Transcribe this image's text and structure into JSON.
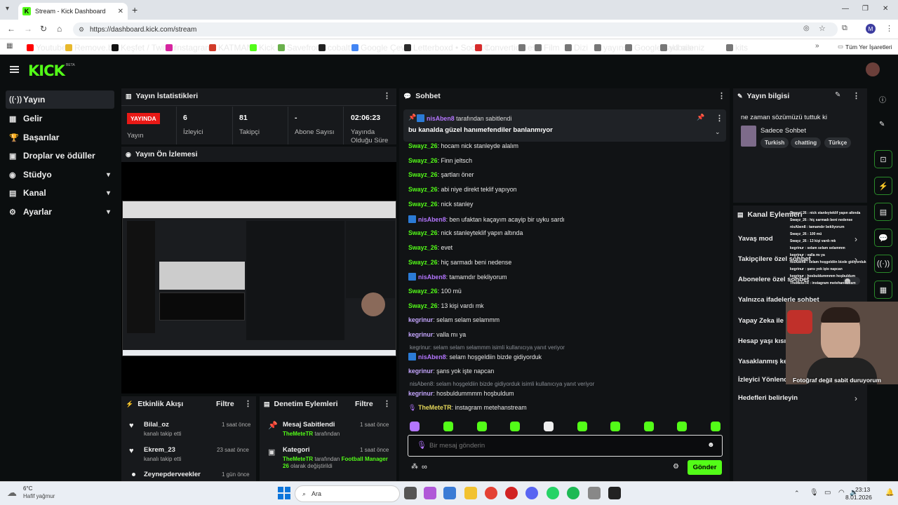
{
  "browser": {
    "tab_title": "Stream - Kick Dashboard",
    "url": "https://dashboard.kick.com/stream",
    "profile_initial": "M",
    "bookmarks": [
      "Youtube",
      "Remove.bg",
      "Keşfet / Twitter",
      "Instagram",
      "KATMAN",
      "Kick",
      "Savefrom",
      "cobalt",
      "Google Çeviri",
      "Letterboxd • Social f...",
      "Convertio",
      "eski",
      "Film",
      "Dizi",
      "yayınss",
      "Google'daki aileniz",
      "yılbası",
      "kits"
    ],
    "all_bookmarks": "Tüm Yer İşaretleri"
  },
  "app": {
    "logo": "KICK",
    "beta": "BETA"
  },
  "sidebar": {
    "items": [
      {
        "label": "Yayın",
        "icon": "((·))"
      },
      {
        "label": "Gelir",
        "icon": "▦"
      },
      {
        "label": "Başarılar",
        "icon": "🏆"
      },
      {
        "label": "Droplar ve ödüller",
        "icon": "▣"
      },
      {
        "label": "Stüdyo",
        "icon": "◉"
      },
      {
        "label": "Kanal",
        "icon": "▤"
      },
      {
        "label": "Ayarlar",
        "icon": "⚙"
      }
    ]
  },
  "stats": {
    "title": "Yayın İstatistikleri",
    "live_badge": "YAYINDA",
    "live_label": "Yayın",
    "viewers": "6",
    "viewers_label": "İzleyici",
    "followers": "81",
    "followers_label": "Takipçi",
    "subs": "-",
    "subs_label": "Abone Sayısı",
    "duration": "02:06:23",
    "duration_label": "Yayında Olduğu Süre"
  },
  "preview": {
    "title": "Yayın Ön İzlemesi"
  },
  "activity": {
    "title": "Etkinlik Akışı",
    "filter": "Filtre",
    "items": [
      {
        "name": "Bilal_oz",
        "sub": "kanalı takip etti",
        "time": "1 saat önce"
      },
      {
        "name": "Ekrem_23",
        "sub": "kanalı takip etti",
        "time": "23 saat önce"
      },
      {
        "name": "Zeynepderveekler",
        "sub": "",
        "time": "1 gün önce"
      }
    ]
  },
  "modlog": {
    "title": "Denetim Eylemleri",
    "filter": "Filtre",
    "items": [
      {
        "title": "Mesaj Sabitlendi",
        "sub1": "TheMeteTR",
        "sub2": " tarafından",
        "time": "1 saat önce"
      },
      {
        "title": "Kategori",
        "sub1": "TheMeteTR",
        "sub2": " tarafından ",
        "sub3": "Football Manager 26",
        "sub4": " olarak değiştirildi",
        "time": "1 saat önce"
      }
    ]
  },
  "chat": {
    "title": "Sohbet",
    "pinned_by": "nisAben8",
    "pinned_suffix": "tarafından sabitlendi",
    "pinned_text": "bu kanalda güzel hanımefendiler banlanmıyor",
    "messages": [
      {
        "user": "Swayz_26",
        "cls": "u1",
        "badge": false,
        "text": ": hocam nick stanleyde alalım"
      },
      {
        "user": "Swayz_26",
        "cls": "u1",
        "badge": false,
        "text": ": Finn jeltsch"
      },
      {
        "user": "Swayz_26",
        "cls": "u1",
        "badge": false,
        "text": ": şartları öner"
      },
      {
        "user": "Swayz_26",
        "cls": "u1",
        "badge": false,
        "text": ": abi niye direkt teklif yapıyon"
      },
      {
        "user": "Swayz_26",
        "cls": "u1",
        "badge": false,
        "text": ": nick stanley"
      },
      {
        "user": "nisAben8",
        "cls": "u2",
        "badge": true,
        "text": ": ben ufaktan kaçayım acayip bir uyku sardı"
      },
      {
        "user": "Swayz_26",
        "cls": "u1",
        "badge": false,
        "text": ": nick stanleyteklif yapın altında"
      },
      {
        "user": "Swayz_26",
        "cls": "u1",
        "badge": false,
        "text": ": evet"
      },
      {
        "user": "Swayz_26",
        "cls": "u1",
        "badge": false,
        "text": ": hiç sarmadı beni nedense"
      },
      {
        "user": "nisAben8",
        "cls": "u2",
        "badge": true,
        "text": ": tamamdır bekliyorum"
      },
      {
        "user": "Swayz_26",
        "cls": "u1",
        "badge": false,
        "text": ": 100 mü"
      },
      {
        "user": "Swayz_26",
        "cls": "u1",
        "badge": false,
        "text": ": 13 kişi vardı mk"
      },
      {
        "user": "kegrinur",
        "cls": "u3",
        "badge": false,
        "text": ": selam selam selammm"
      },
      {
        "user": "kegrinur",
        "cls": "u3",
        "badge": false,
        "text": ": valla mı ya"
      }
    ],
    "reply1": "kegrinur: selam selam selammm isimli kullanıcıya yanıt veriyor",
    "msg_after1": {
      "user": "nisAben8",
      "text": ": selam hoşgeldiin bizde gidiyorduk"
    },
    "msg_after1b": {
      "user": "kegrinur",
      "text": ": şans yok işte napcan"
    },
    "reply2": "nisAben8: selam hoşgeldiin bizde gidiyorduk isimli kullanıcıya yanıt veriyor",
    "msg_after2": {
      "user": "kegrinur",
      "text": ": hosbuldummmm hoşbuldum"
    },
    "msg_last": {
      "user": "TheMeteTR",
      "text": ": instagram metehanstream"
    },
    "input_placeholder": "Bir mesaj gönderin",
    "send": "Gönder"
  },
  "info": {
    "title": "Yayın bilgisi",
    "stream_title": "ne zaman sözümüzü tuttuk ki",
    "category": "Sadece Sohbet",
    "tags": [
      "Turkish",
      "chatting",
      "Türkçe"
    ]
  },
  "channel_actions": {
    "title": "Kanal Eylemleri",
    "items": [
      "Yavaş mod",
      "Takipçilere özel sohbet",
      "Abonelere özel sohbet",
      "Yalnızca ifadelerle sohbet",
      "Yapay Zeka ile",
      "Hesap yaşı kısıtlaması",
      "Yasaklanmış kelimeler",
      "İzleyici Yönlendir",
      "Hedefleri belirleyin"
    ]
  },
  "overlay": {
    "lines": [
      "Swayz_26 : nick stanleyteklif yapın altında",
      "Swayz_26 : hiç sarmadı beni nedense",
      "nisAben8 : tamamdır bekliyorum",
      "Swayz_26 : 100 mü",
      "Swayz_26 : 13 kişi vardı mk",
      "kegrinur : selam selam selammm",
      "kegrinur : valla mı ya",
      "nisAben8 : selam hoşgeldiin bizde gidiyorduk",
      "kegrinur : şans yok işte napcan",
      "kegrinur : hosbuldummmm hoşbuldum",
      "TheMeteTR : instagram metehanstream"
    ],
    "caption": "Fotoğraf değil sabit duruyorum"
  },
  "taskbar": {
    "weather_temp": "6°C",
    "weather_desc": "Hafif yağmur",
    "search": "Ara",
    "time": "23:13",
    "date": "8.01.2026"
  }
}
